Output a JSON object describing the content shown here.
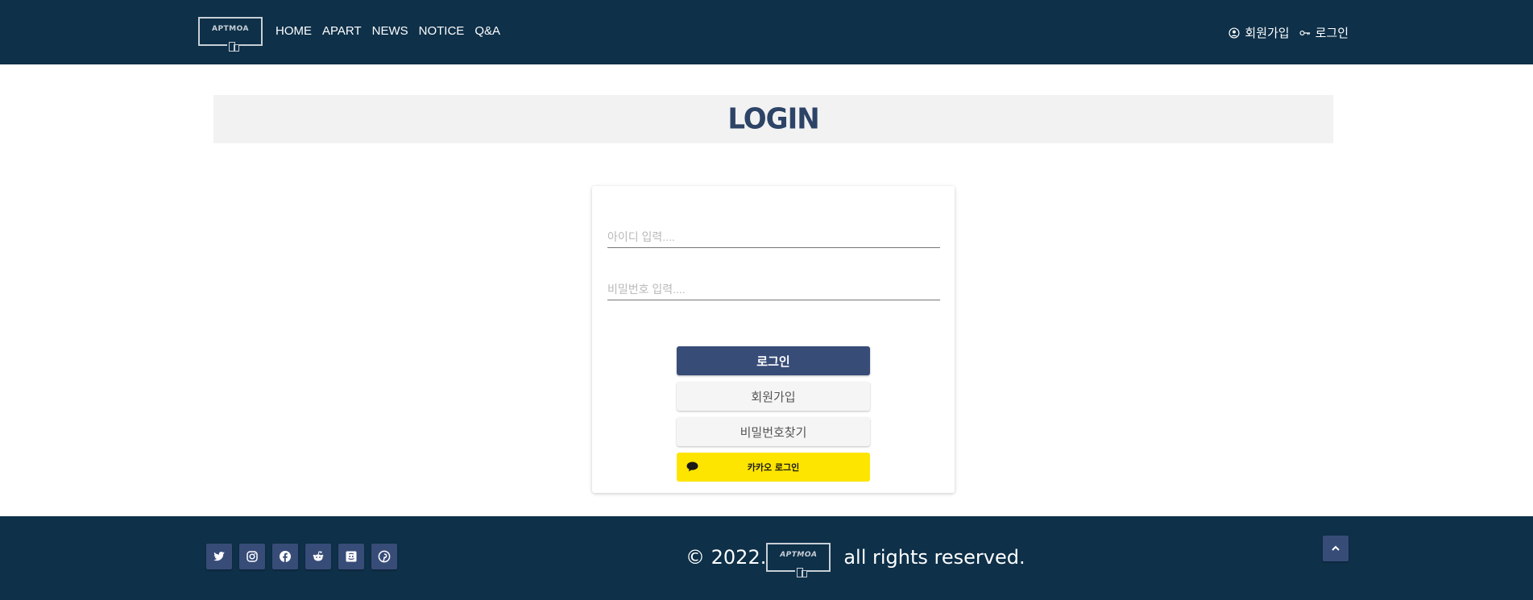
{
  "header": {
    "logo_text": "APTMOA",
    "nav": [
      "HOME",
      "APART",
      "NEWS",
      "NOTICE",
      "Q&A"
    ],
    "signup_label": "회원가입",
    "login_label": "로그인"
  },
  "page": {
    "title": "LOGIN"
  },
  "login_form": {
    "id_placeholder": "아이디 입력....",
    "password_placeholder": "비밀번호 입력....",
    "login_button": "로그인",
    "signup_button": "회원가입",
    "find_password_button": "비밀번호찾기",
    "kakao_button": "카카오 로그인"
  },
  "footer": {
    "copyright_prefix": "© 2022.",
    "logo_text": "APTMOA",
    "copyright_suffix": "all rights reserved.",
    "social_icons": [
      "twitter-icon",
      "instagram-icon",
      "facebook-icon",
      "reddit-icon",
      "discord-icon",
      "pinterest-icon"
    ]
  },
  "colors": {
    "header_bg": "#0e3049",
    "accent": "#384c78",
    "title": "#2d4467",
    "kakao": "#fee500",
    "banner_bg": "#f2f2f2"
  }
}
